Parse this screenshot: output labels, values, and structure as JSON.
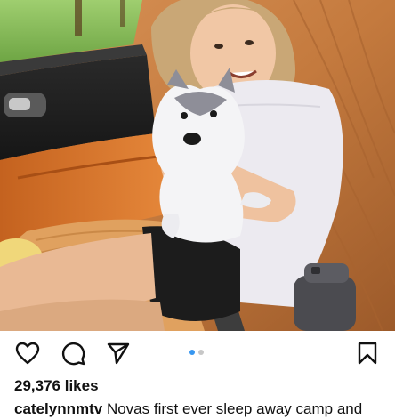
{
  "post": {
    "likes_text": "29,376 likes",
    "username": "catelynnmtv",
    "caption": "Novas first ever sleep away camp and"
  },
  "carousel": {
    "total": 2,
    "active_index": 0,
    "active_color": "#3897f0",
    "inactive_color": "#c7c7c7"
  },
  "icons": {
    "like": "heart-icon",
    "comment": "comment-icon",
    "share": "send-icon",
    "save": "bookmark-icon"
  },
  "photo": {
    "description_icon": "photo"
  }
}
